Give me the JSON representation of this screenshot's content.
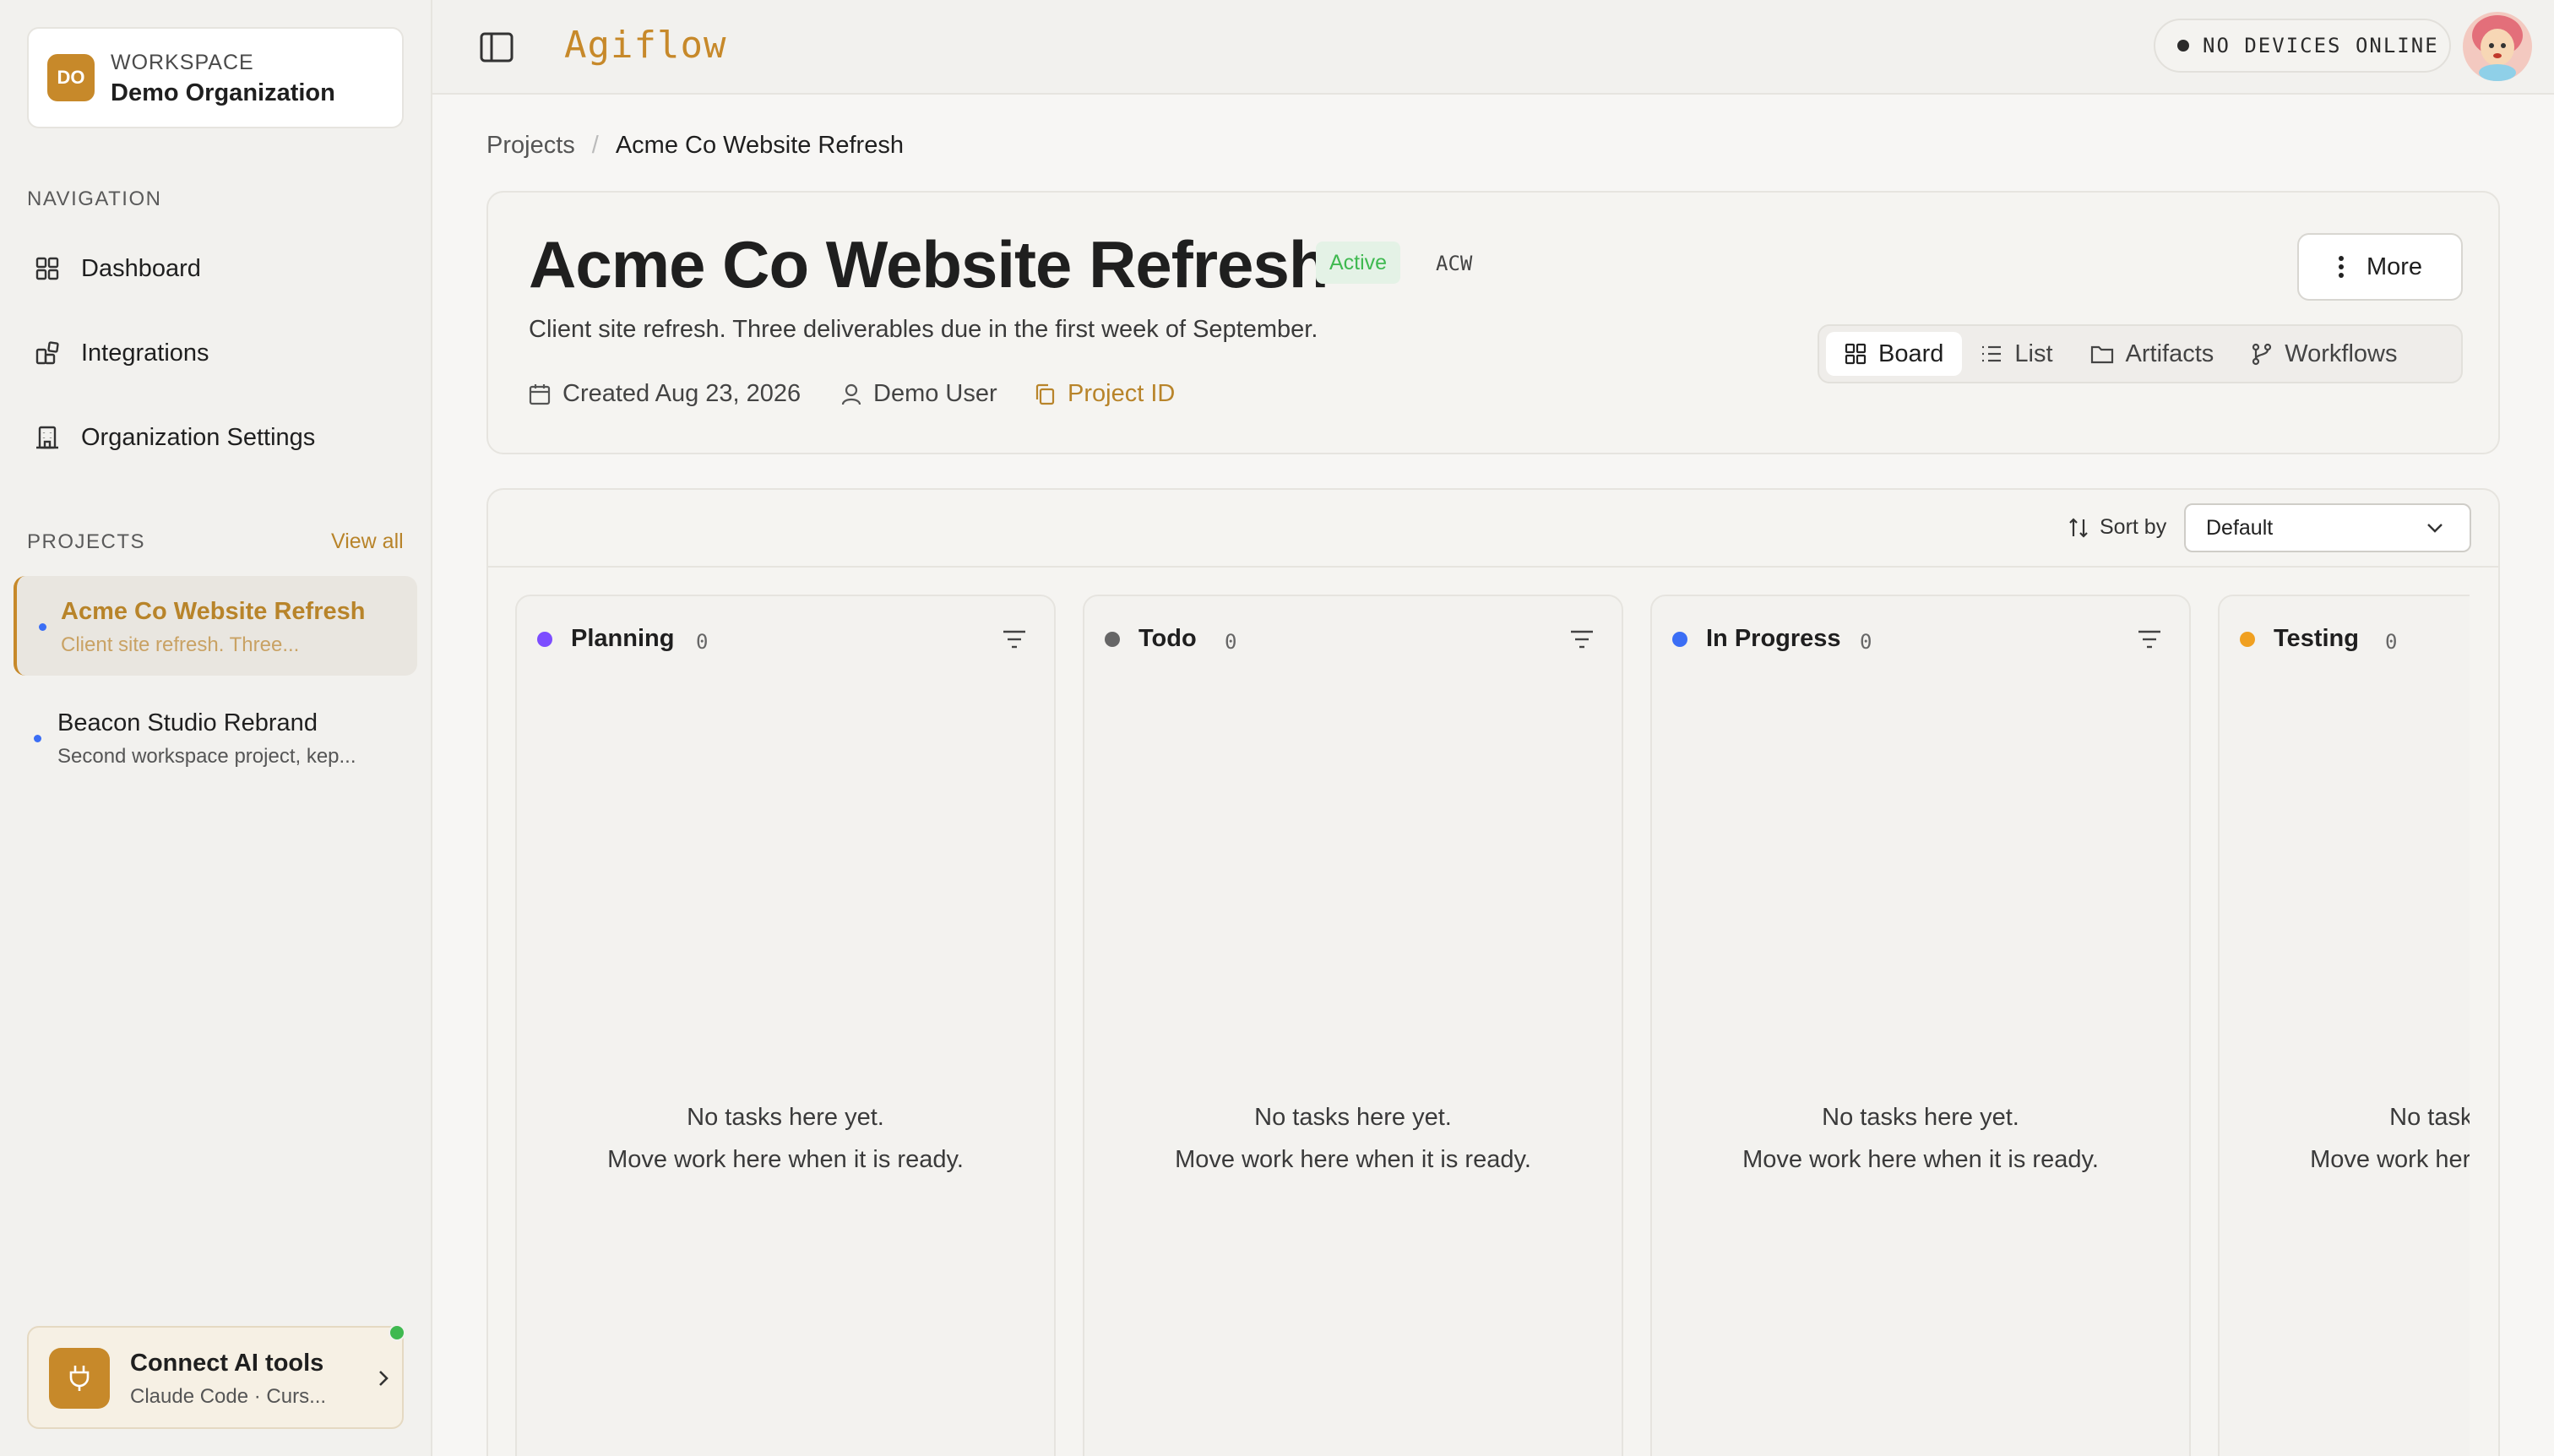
{
  "workspace": {
    "initials": "DO",
    "label": "WORKSPACE",
    "name": "Demo Organization"
  },
  "navigation": {
    "label": "NAVIGATION",
    "items": [
      {
        "label": "Dashboard",
        "icon": "grid-icon"
      },
      {
        "label": "Integrations",
        "icon": "puzzle-icon"
      },
      {
        "label": "Organization Settings",
        "icon": "building-icon"
      }
    ]
  },
  "projects_section": {
    "label": "PROJECTS",
    "view_all": "View all",
    "items": [
      {
        "name": "Acme Co Website Refresh",
        "desc": "Client site refresh. Three...",
        "active": true
      },
      {
        "name": "Beacon Studio Rebrand",
        "desc": "Second workspace project, kep...",
        "active": false
      }
    ]
  },
  "connect": {
    "title": "Connect AI tools",
    "subtitle": "Claude Code · Curs...",
    "icon": "plug-icon"
  },
  "topbar": {
    "brand": "Agiflow",
    "devices_status": "NO DEVICES ONLINE"
  },
  "breadcrumb": {
    "root": "Projects",
    "separator": "/",
    "current": "Acme Co Website Refresh"
  },
  "project": {
    "title": "Acme Co Website Refresh",
    "status": "Active",
    "key": "ACW",
    "description": "Client site refresh. Three deliverables due in the first week of September.",
    "created": "Created Aug 23, 2026",
    "owner": "Demo User",
    "id_label": "Project ID",
    "more_label": "More"
  },
  "view_tabs": [
    {
      "label": "Board",
      "active": true
    },
    {
      "label": "List",
      "active": false
    },
    {
      "label": "Artifacts",
      "active": false
    },
    {
      "label": "Workflows",
      "active": false
    }
  ],
  "board": {
    "sort_label": "Sort by",
    "sort_value": "Default",
    "empty_line1": "No tasks here yet.",
    "empty_line2": "Move work here when it is ready.",
    "columns": [
      {
        "name": "Planning",
        "count": "0",
        "color": "#7c4dff"
      },
      {
        "name": "Todo",
        "count": "0",
        "color": "#666666"
      },
      {
        "name": "In Progress",
        "count": "0",
        "color": "#3b6ef5"
      },
      {
        "name": "Testing",
        "count": "0",
        "color": "#f0a020"
      }
    ]
  },
  "colors": {
    "accent": "#c7892a",
    "active_status": "#3fb950"
  }
}
